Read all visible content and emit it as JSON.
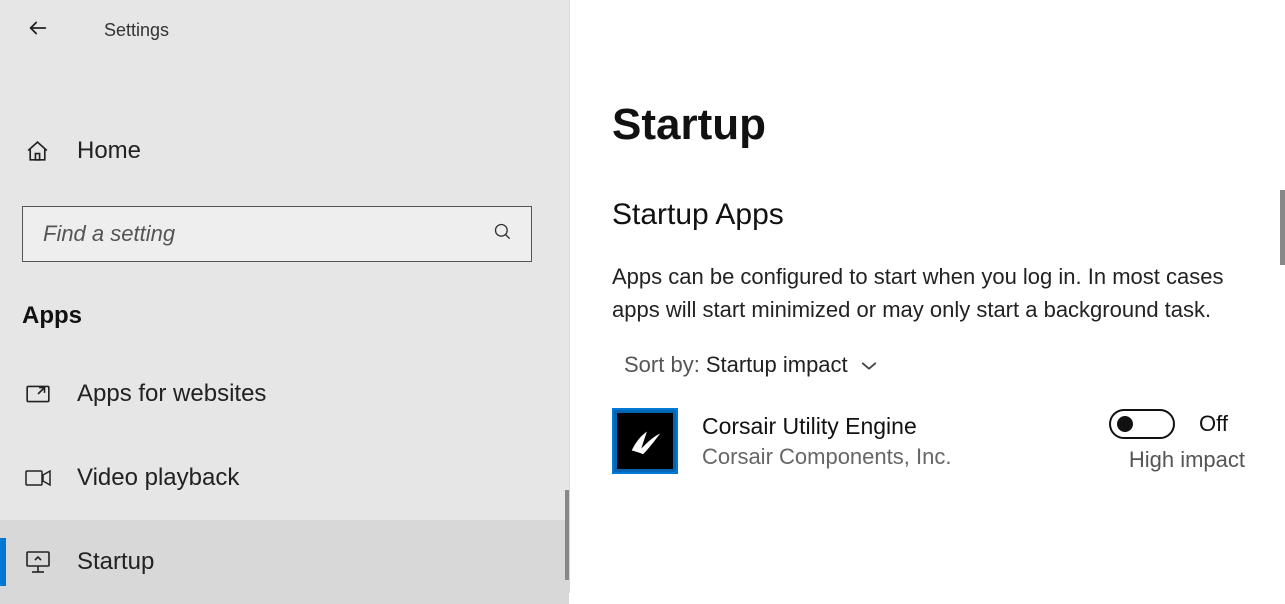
{
  "window": {
    "title": "Settings"
  },
  "sidebar": {
    "home_label": "Home",
    "search_placeholder": "Find a setting",
    "section_label": "Apps",
    "items": [
      {
        "icon": "apps-for-websites-icon",
        "label": "Apps for websites",
        "selected": false
      },
      {
        "icon": "video-playback-icon",
        "label": "Video playback",
        "selected": false
      },
      {
        "icon": "startup-icon",
        "label": "Startup",
        "selected": true
      }
    ]
  },
  "page": {
    "title": "Startup",
    "subtitle": "Startup Apps",
    "description": "Apps can be configured to start when you log in. In most cases apps will start minimized or may only start a background task.",
    "sort_prefix": "Sort by:",
    "sort_value": "Startup impact"
  },
  "apps": [
    {
      "name": "Corsair Utility Engine",
      "publisher": "Corsair Components, Inc.",
      "state": "Off",
      "impact": "High impact"
    }
  ]
}
